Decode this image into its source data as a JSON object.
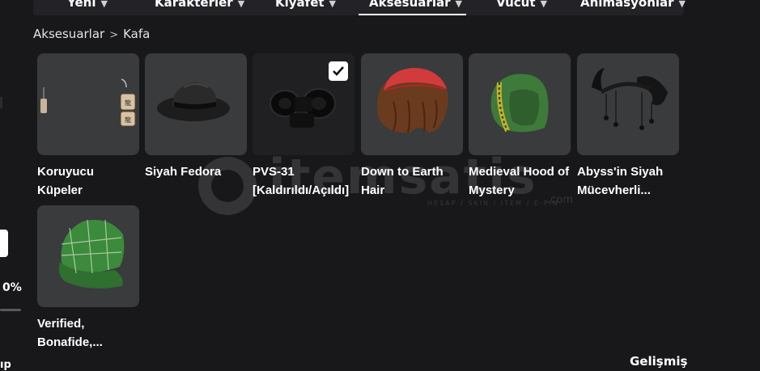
{
  "tabs": [
    {
      "label": "Yeni"
    },
    {
      "label": "Karakterler"
    },
    {
      "label": "Kıyafet"
    },
    {
      "label": "Aksesuarlar"
    },
    {
      "label": "Vücut"
    },
    {
      "label": "Animasyonlar"
    }
  ],
  "active_tab": "Aksesuarlar",
  "breadcrumb": {
    "parent": "Aksesuarlar",
    "separator": ">",
    "current": "Kafa"
  },
  "items": [
    {
      "name": "Koruyucu Küpeler",
      "selected": false
    },
    {
      "name": "Siyah Fedora",
      "selected": false
    },
    {
      "name": "PVS-31 [Kaldırıldı/Açıldı]",
      "selected": true
    },
    {
      "name": "Down to Earth Hair",
      "selected": false
    },
    {
      "name": "Medieval Hood of Mystery",
      "selected": false
    },
    {
      "name": "Abyss'in Siyah Mücevherli...",
      "selected": false
    },
    {
      "name": "Verified, Bonafide,...",
      "selected": false
    }
  ],
  "watermark": {
    "text": "itemsatis",
    "sub": "HESAP / SKIN / ITEM / E-PIN",
    "suffix": ".com"
  },
  "left_panel": {
    "percent": "0%",
    "bottom_text": "ıp"
  },
  "advanced_label": "Gelişmiş",
  "colors": {
    "background": "#18181b",
    "card": "#393b3d",
    "card_selected": "#202023",
    "tabbar": "#232327"
  }
}
